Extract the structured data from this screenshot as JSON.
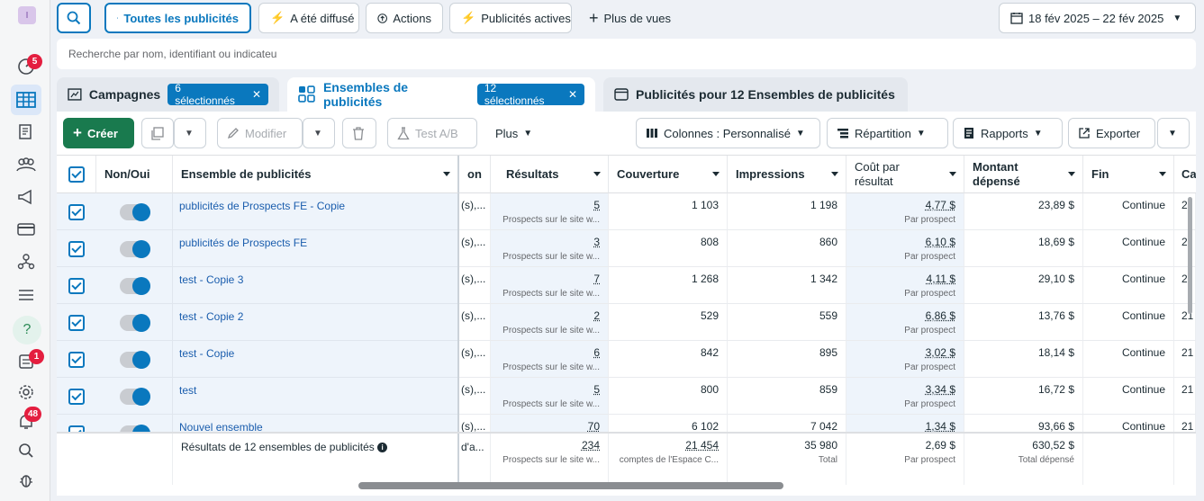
{
  "nav": {
    "account_initial": "I",
    "badges": {
      "notifications": "5",
      "inbox": "1",
      "alerts": "48"
    },
    "help_glyph": "?"
  },
  "topbar": {
    "all_ads": "Toutes les publicités",
    "delivered": "A été diffusé",
    "actions": "Actions",
    "active_ads": "Publicités actives",
    "more_views": "Plus de vues",
    "date_range": "18 fév 2025 – 22 fév 2025"
  },
  "search": {
    "placeholder": "Recherche par nom, identifiant ou indicateu"
  },
  "tabs": {
    "campaigns": {
      "label": "Campagnes",
      "pill": "6 sélectionnés"
    },
    "adsets": {
      "label": "Ensembles de publicités",
      "pill": "12 sélectionnés"
    },
    "ads": {
      "label": "Publicités pour 12 Ensembles de publicités"
    }
  },
  "toolbar": {
    "create": "Créer",
    "edit": "Modifier",
    "ab_test": "Test A/B",
    "more": "Plus",
    "columns": "Colonnes : Personnalisé",
    "breakdown": "Répartition",
    "reports": "Rapports",
    "export": "Exporter"
  },
  "table": {
    "headers": {
      "onoff": "Non/Oui",
      "name": "Ensemble de publicités",
      "partial": "on",
      "results": "Résultats",
      "reach": "Couverture",
      "impressions": "Impressions",
      "cost1": "Coût par",
      "cost2": "résultat",
      "spent1": "Montant",
      "spent2": "dépensé",
      "end": "Fin",
      "next": "Ca"
    },
    "rows": [
      {
        "name": "publicités de Prospects FE - Copie",
        "partial": "(s),...",
        "results": "5",
        "results_sub": "Prospects sur le site w...",
        "reach": "1 103",
        "impressions": "1 198",
        "cost": "4,77 $",
        "cost_sub": "Par prospect",
        "spent": "23,89 $",
        "end": "Continue",
        "next": "2"
      },
      {
        "name": "publicités de Prospects FE",
        "partial": "(s),...",
        "results": "3",
        "results_sub": "Prospects sur le site w...",
        "reach": "808",
        "impressions": "860",
        "cost": "6,10 $",
        "cost_sub": "Par prospect",
        "spent": "18,69 $",
        "end": "Continue",
        "next": "2"
      },
      {
        "name": "test - Copie 3",
        "partial": "(s),...",
        "results": "7",
        "results_sub": "Prospects sur le site w...",
        "reach": "1 268",
        "impressions": "1 342",
        "cost": "4,11 $",
        "cost_sub": "Par prospect",
        "spent": "29,10 $",
        "end": "Continue",
        "next": "2"
      },
      {
        "name": "test - Copie 2",
        "partial": "(s),...",
        "results": "2",
        "results_sub": "Prospects sur le site w...",
        "reach": "529",
        "impressions": "559",
        "cost": "6,86 $",
        "cost_sub": "Par prospect",
        "spent": "13,76 $",
        "end": "Continue",
        "next": "21"
      },
      {
        "name": "test - Copie",
        "partial": "(s),...",
        "results": "6",
        "results_sub": "Prospects sur le site w...",
        "reach": "842",
        "impressions": "895",
        "cost": "3,02 $",
        "cost_sub": "Par prospect",
        "spent": "18,14 $",
        "end": "Continue",
        "next": "21"
      },
      {
        "name": "test",
        "partial": "(s),...",
        "results": "5",
        "results_sub": "Prospects sur le site w...",
        "reach": "800",
        "impressions": "859",
        "cost": "3,34 $",
        "cost_sub": "Par prospect",
        "spent": "16,72 $",
        "end": "Continue",
        "next": "21"
      },
      {
        "name": "Nouvel ensemble",
        "partial": "(s),...",
        "results": "70",
        "results_sub": "",
        "reach": "6 102",
        "impressions": "7 042",
        "cost": "1,34 $",
        "cost_sub": "",
        "spent": "93,66 $",
        "end": "Continue",
        "next": "21"
      }
    ],
    "footer": {
      "label": "Résultats de 12 ensembles de publicités",
      "partial": "d'a...",
      "results": "234",
      "results_sub": "Prospects sur le site w...",
      "reach": "21 454",
      "reach_sub": "comptes de l'Espace C...",
      "impressions": "35 980",
      "impressions_sub": "Total",
      "cost": "2,69 $",
      "cost_sub": "Par prospect",
      "spent": "630,52 $",
      "spent_sub": "Total dépensé"
    }
  }
}
